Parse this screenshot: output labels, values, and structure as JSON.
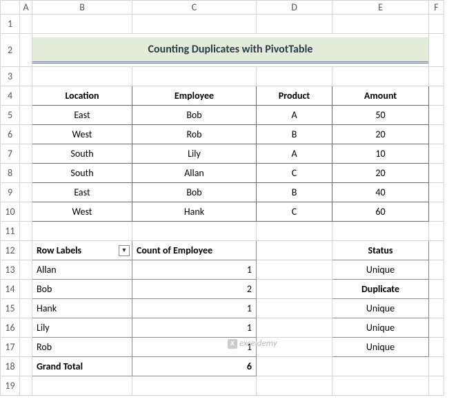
{
  "columns": [
    "A",
    "B",
    "C",
    "D",
    "E",
    "F"
  ],
  "title": "Counting Duplicates with PivotTable",
  "table1": {
    "headers": {
      "location": "Location",
      "employee": "Employee",
      "product": "Product",
      "amount": "Amount"
    },
    "rows": [
      {
        "location": "East",
        "employee": "Bob",
        "product": "A",
        "amount": "50"
      },
      {
        "location": "West",
        "employee": "Rob",
        "product": "B",
        "amount": "20"
      },
      {
        "location": "South",
        "employee": "Lily",
        "product": "A",
        "amount": "10"
      },
      {
        "location": "South",
        "employee": "Allan",
        "product": "C",
        "amount": "20"
      },
      {
        "location": "East",
        "employee": "Bob",
        "product": "B",
        "amount": "40"
      },
      {
        "location": "West",
        "employee": "Hank",
        "product": "C",
        "amount": "60"
      }
    ]
  },
  "pivot": {
    "headers": {
      "rowlabels": "Row Labels",
      "count": "Count of Employee",
      "status": "Status"
    },
    "rows": [
      {
        "name": "Allan",
        "count": "1",
        "status": "Unique",
        "dup": false
      },
      {
        "name": "Bob",
        "count": "2",
        "status": "Duplicate",
        "dup": true
      },
      {
        "name": "Hank",
        "count": "1",
        "status": "Unique",
        "dup": false
      },
      {
        "name": "Lily",
        "count": "1",
        "status": "Unique",
        "dup": false
      },
      {
        "name": "Rob",
        "count": "1",
        "status": "Unique",
        "dup": false
      }
    ],
    "grand": {
      "label": "Grand Total",
      "count": "6"
    }
  },
  "watermark": "exceldemy"
}
